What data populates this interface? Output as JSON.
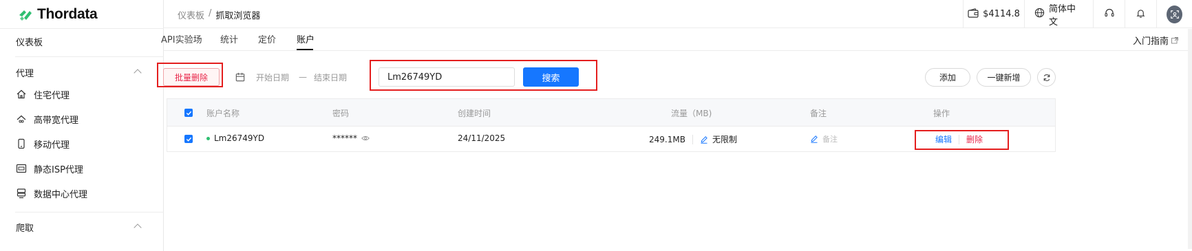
{
  "brand": {
    "name": "Thordata",
    "accent": "#2fbf71"
  },
  "sidebar": {
    "dashboard": "仪表板",
    "proxy_group": "代理",
    "items": [
      {
        "label": "住宅代理",
        "icon": "home-icon"
      },
      {
        "label": "高带宽代理",
        "icon": "infinity-home-icon"
      },
      {
        "label": "移动代理",
        "icon": "mobile-icon"
      },
      {
        "label": "静态ISP代理",
        "icon": "isp-icon"
      },
      {
        "label": "数据中心代理",
        "icon": "server-icon"
      }
    ],
    "next_group": "爬取"
  },
  "header": {
    "breadcrumb_root": "仪表板",
    "breadcrumb_sep": "/",
    "breadcrumb_current": "抓取浏览器",
    "balance": "$4114.8",
    "language": "简体中文"
  },
  "tabs": [
    {
      "label": "API实验场"
    },
    {
      "label": "统计"
    },
    {
      "label": "定价"
    },
    {
      "label": "账户"
    }
  ],
  "guide_link": "入门指南",
  "toolbar": {
    "bulk_delete": "批量删除",
    "start_date": "开始日期",
    "date_sep": "—",
    "end_date": "结束日期",
    "search_value": "Lm26749YD",
    "search_button": "搜索",
    "add_button": "添加",
    "quick_add_button": "一键新增"
  },
  "table": {
    "columns": [
      "账户名称",
      "密码",
      "创建时间",
      "流量（MB)",
      "备注",
      "操作"
    ],
    "rows": [
      {
        "name": "Lm26749YD",
        "password": "******",
        "created": "24/11/2025",
        "traffic": "249.1MB",
        "limit": "无限制",
        "note": "备注",
        "edit": "编辑",
        "delete": "删除"
      }
    ]
  }
}
